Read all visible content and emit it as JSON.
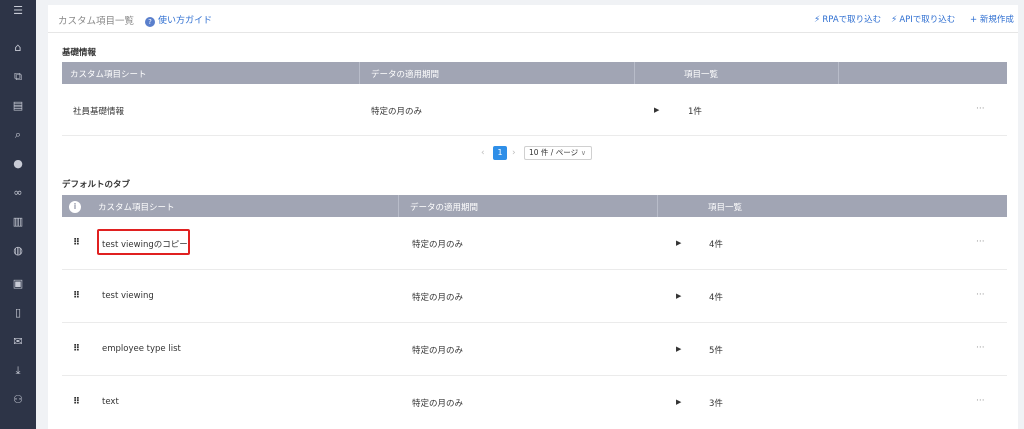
{
  "sidebar": {
    "items": [
      {
        "icon": "menu-icon",
        "glyph": "☰"
      },
      {
        "icon": "home-icon",
        "glyph": "⌂"
      },
      {
        "icon": "org-chart-icon",
        "glyph": "⧉"
      },
      {
        "icon": "document-icon",
        "glyph": "▤"
      },
      {
        "icon": "search-icon",
        "glyph": "⌕"
      },
      {
        "icon": "chat-icon",
        "glyph": "●"
      },
      {
        "icon": "link-icon",
        "glyph": "∞"
      },
      {
        "icon": "chart-icon",
        "glyph": "▥"
      },
      {
        "icon": "globe-icon",
        "glyph": "◍"
      },
      {
        "icon": "contact-icon",
        "glyph": "▣"
      },
      {
        "icon": "book-icon",
        "glyph": "▯"
      },
      {
        "icon": "mail-icon",
        "glyph": "✉"
      },
      {
        "icon": "download-icon",
        "glyph": "⤓"
      },
      {
        "icon": "user-settings-icon",
        "glyph": "⚇"
      }
    ]
  },
  "header": {
    "title": "カスタム項目一覧",
    "guide_label": "使い方ガイド",
    "rpa_label": "RPAで取り込む",
    "api_label": "APIで取り込む",
    "new_label": "+ 新規作成"
  },
  "basic": {
    "section_title": "基礎情報",
    "columns": [
      "カスタム項目シート",
      "データの適用期間",
      "項目一覧"
    ],
    "rows": [
      {
        "name": "社員基礎情報",
        "period": "特定の月のみ",
        "count": "1件",
        "more": "···"
      }
    ]
  },
  "pagination": {
    "prev": "‹",
    "current": "1",
    "next": "›",
    "page_size": "10 件 / ページ",
    "caret": "∨"
  },
  "default_tab": {
    "section_title": "デフォルトのタブ",
    "info": "i",
    "columns": [
      "カスタム項目シート",
      "データの適用期間",
      "項目一覧"
    ],
    "rows": [
      {
        "name": "test viewingのコピー",
        "period": "特定の月のみ",
        "count": "4件",
        "more": "···"
      },
      {
        "name": "test viewing",
        "period": "特定の月のみ",
        "count": "4件",
        "more": "···"
      },
      {
        "name": "employee type list",
        "period": "特定の月のみ",
        "count": "5件",
        "more": "···"
      },
      {
        "name": "text",
        "period": "特定の月のみ",
        "count": "3件",
        "more": "···"
      }
    ]
  },
  "colors": {
    "sidebar_bg": "#2d3447",
    "table_header_bg": "#a1a5b4",
    "link": "#2f6fd1",
    "page_active": "#2f8fe8",
    "highlight": "#e02020"
  }
}
